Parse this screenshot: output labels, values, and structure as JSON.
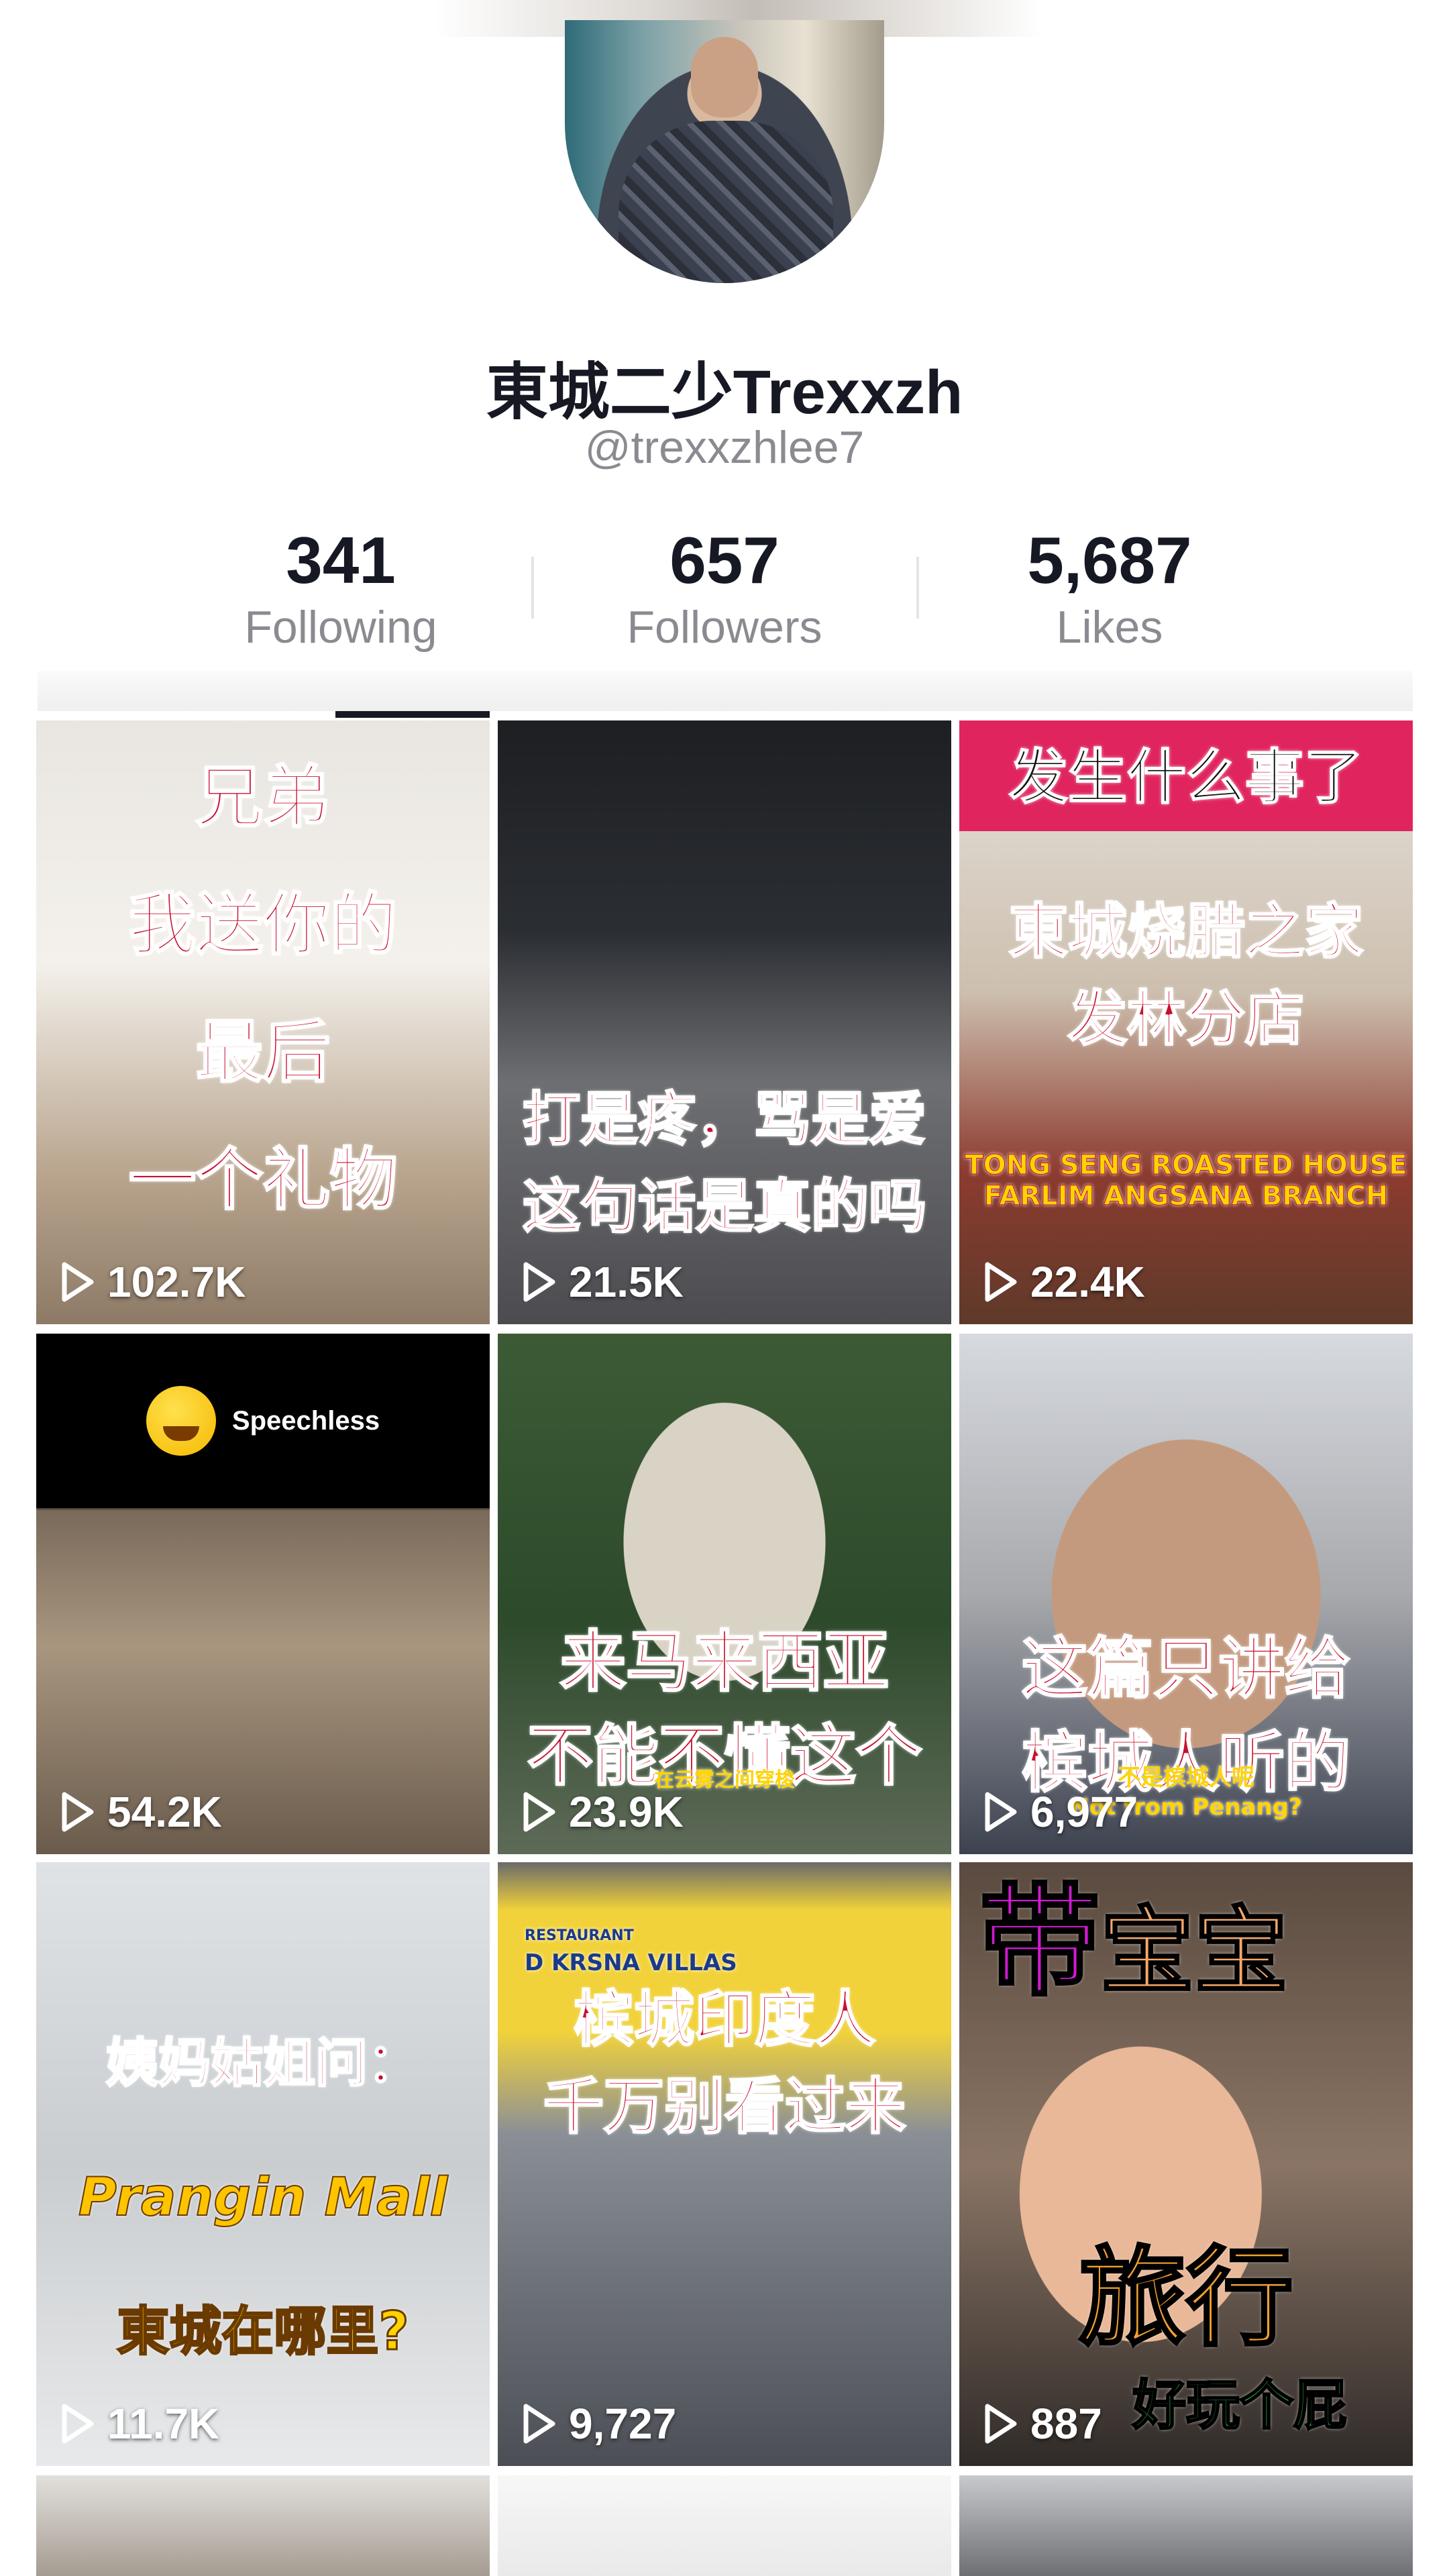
{
  "profile": {
    "display_name": "東城二少Trexxzh",
    "handle": "@trexxzhlee7"
  },
  "stats": [
    {
      "value": "341",
      "label": "Following"
    },
    {
      "value": "657",
      "label": "Followers"
    },
    {
      "value": "5,687",
      "label": "Likes"
    }
  ],
  "videos": [
    {
      "views": "102.7K",
      "caption": [
        "兄弟",
        "我送你的",
        "最后",
        "一个礼物"
      ]
    },
    {
      "views": "21.5K",
      "caption": [
        "打是疼，骂是爱",
        "这句话是真的吗"
      ]
    },
    {
      "views": "22.4K",
      "caption": [
        "发生什么事了",
        "東城烧腊之家",
        "发林分店"
      ],
      "subcaption": [
        "TONG SENG ROASTED HOUSE",
        "FARLIM ANGSANA BRANCH"
      ]
    },
    {
      "views": "54.2K",
      "caption": [],
      "label": "Speechless"
    },
    {
      "views": "23.9K",
      "caption": [
        "来马来西亚",
        "不能不懂这个"
      ],
      "subcaption": [
        "在云雾之间穿梭"
      ]
    },
    {
      "views": "6,977",
      "caption": [
        "这篇只讲给",
        "槟城人听的"
      ],
      "subcaption": [
        "不是槟城人呢",
        "Not from Penang?"
      ]
    },
    {
      "views": "11.7K",
      "caption": [
        "姨妈姑姐问：",
        "Prangin Mall",
        "東城在哪里?"
      ]
    },
    {
      "views": "9,727",
      "caption": [
        "槟城印度人",
        "千万别看过来"
      ],
      "subcaption": [
        "RESTAURANT",
        "D KRSNA VILLAS"
      ]
    },
    {
      "views": "887",
      "caption": [
        "带",
        "宝宝",
        "旅行",
        "好玩个屁"
      ]
    }
  ],
  "colors": {
    "text_primary": "#161823",
    "text_secondary": "#8a8b91",
    "caption_red": "#c8102e"
  }
}
